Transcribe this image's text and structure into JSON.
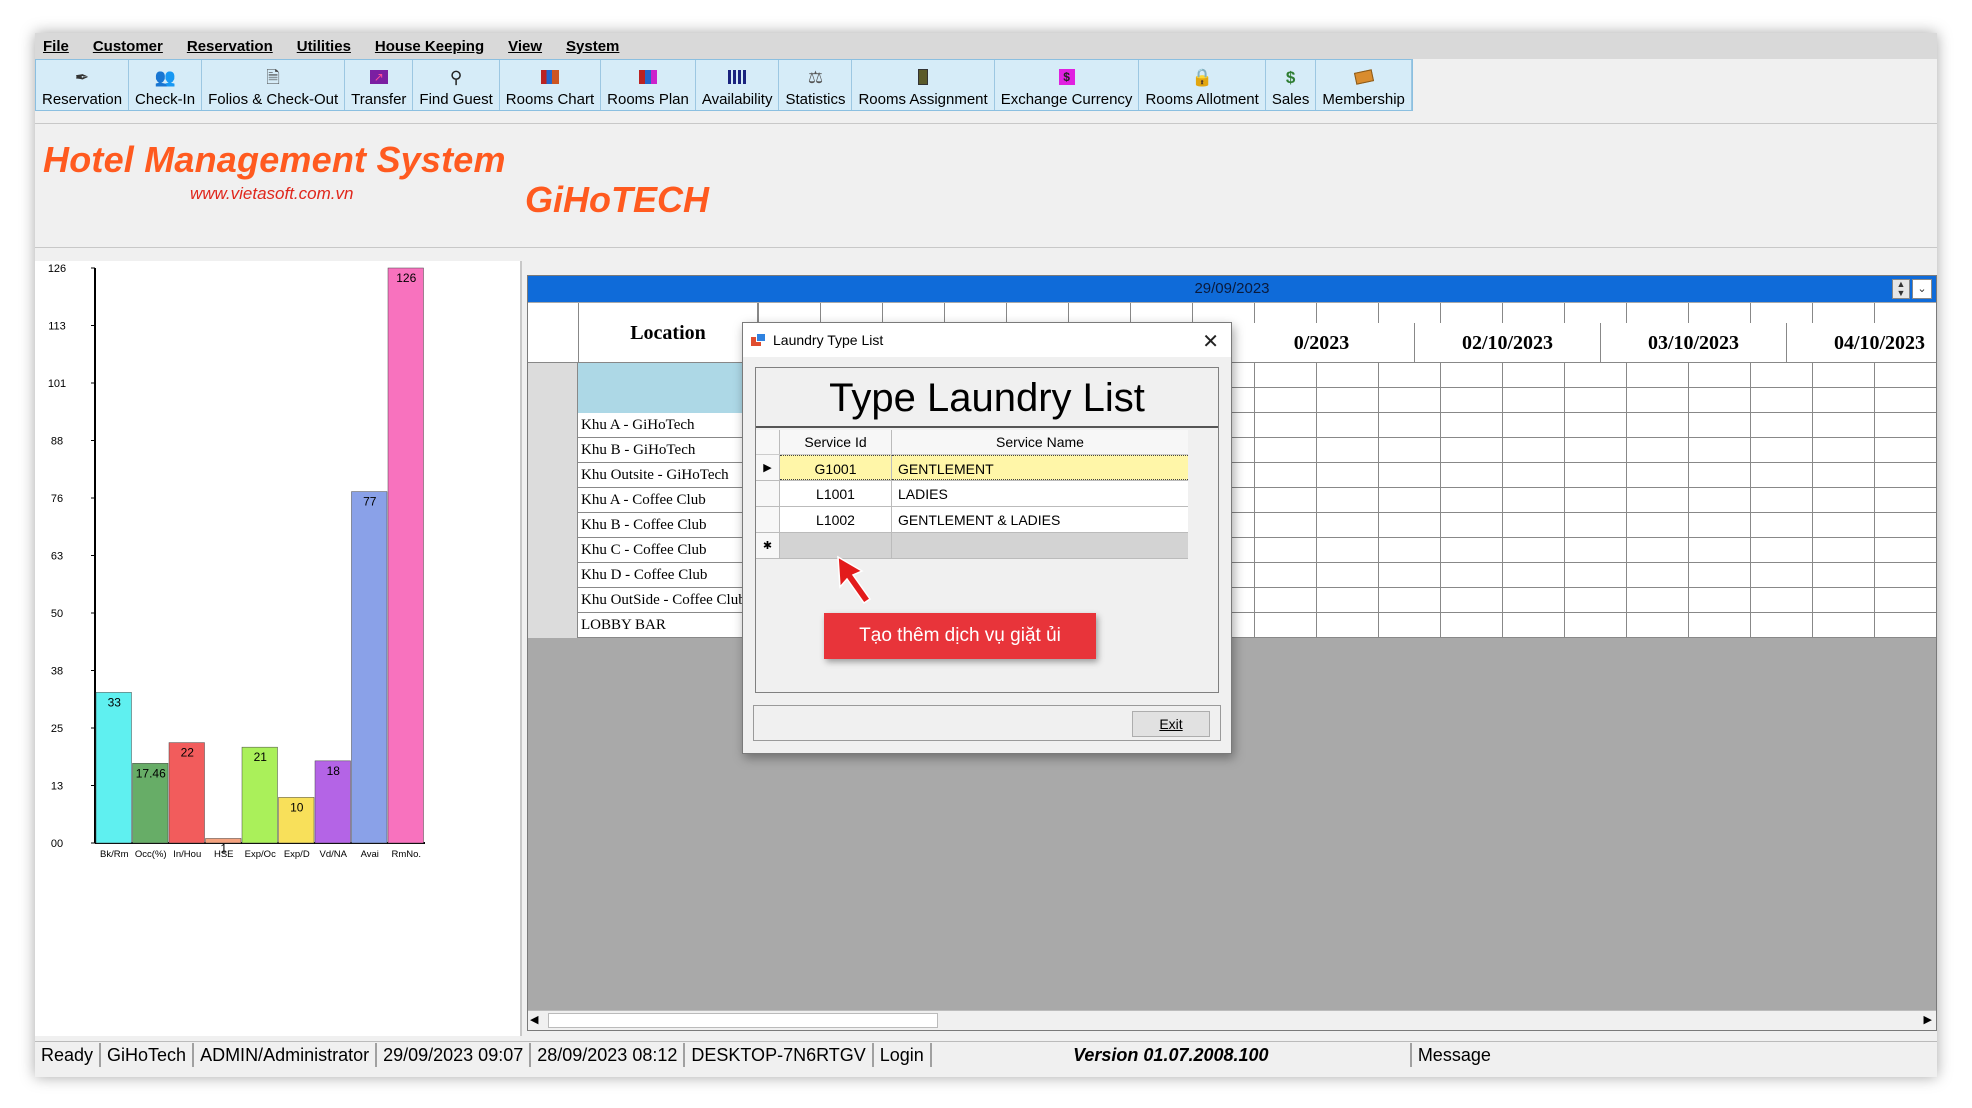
{
  "menu": [
    "File",
    "Customer",
    "Reservation",
    "Utilities",
    "House Keeping",
    "View",
    "System"
  ],
  "toolbar": [
    {
      "label": "Reservation",
      "icon": "pen-icon"
    },
    {
      "label": "Check-In",
      "icon": "people-icon"
    },
    {
      "label": "Folios & Check-Out",
      "icon": "folio-icon"
    },
    {
      "label": "Transfer",
      "icon": "transfer-icon"
    },
    {
      "label": "Find Guest",
      "icon": "binoculars-icon"
    },
    {
      "label": "Rooms Chart",
      "icon": "rooms-chart-icon"
    },
    {
      "label": "Rooms Plan",
      "icon": "rooms-plan-icon"
    },
    {
      "label": "Availability",
      "icon": "availability-icon"
    },
    {
      "label": "Statistics",
      "icon": "statistics-icon"
    },
    {
      "label": "Rooms Assignment",
      "icon": "assignment-icon"
    },
    {
      "label": "Exchange Currency",
      "icon": "currency-icon"
    },
    {
      "label": "Rooms Allotment",
      "icon": "lock-icon"
    },
    {
      "label": "Sales",
      "icon": "money-icon"
    },
    {
      "label": "Membership",
      "icon": "book-icon"
    }
  ],
  "header": {
    "title": "Hotel Management System",
    "website": "www.vietasoft.com.vn",
    "brand": "GiHoTECH"
  },
  "chart_data": {
    "type": "bar",
    "categories": [
      "Bk/Rm",
      "Occ(%)",
      "In/Hou",
      "HSE",
      "Exp/Oc",
      "Exp/D",
      "Vd/NA",
      "Avai",
      "RmNo."
    ],
    "values": [
      33,
      17.46,
      22,
      1,
      21,
      10,
      18,
      77,
      126
    ],
    "labels": [
      "33",
      "17.46",
      "22",
      "1",
      "21",
      "10",
      "18",
      "77",
      "126"
    ],
    "colors": [
      "#5ff0f0",
      "#67ad67",
      "#f25c5c",
      "#f4a27e",
      "#aaf05a",
      "#f8e05a",
      "#b464e6",
      "#8aa1e8",
      "#f872be"
    ],
    "yticks": [
      "00",
      "13",
      "25",
      "38",
      "50",
      "63",
      "76",
      "88",
      "101",
      "113",
      "126"
    ],
    "ylim": [
      0,
      126
    ],
    "grid": false
  },
  "grid": {
    "date": "29/09/2023",
    "location_header": "Location",
    "date_headers": [
      "0/2023",
      "02/10/2023",
      "03/10/2023",
      "04/10/2023"
    ],
    "locations": [
      "",
      "",
      "Khu A - GiHoTech",
      "Khu B - GiHoTech",
      "Khu Outsite - GiHoTech",
      "Khu A - Coffee Club",
      "Khu B - Coffee Club",
      "Khu C - Coffee Club",
      "Khu D - Coffee Club",
      "Khu OutSide - Coffee Club",
      "LOBBY BAR"
    ]
  },
  "dialog": {
    "title": "Laundry Type List",
    "heading": "Type Laundry List",
    "columns": [
      "Service Id",
      "Service Name"
    ],
    "rows": [
      {
        "id": "G1001",
        "name": "GENTLEMENT"
      },
      {
        "id": "L1001",
        "name": "LADIES"
      },
      {
        "id": "L1002",
        "name": "GENTLEMENT & LADIES"
      }
    ],
    "new_row_marker": "✱",
    "exit_label": "Exit"
  },
  "callout": "Tạo thêm dịch vụ giặt ủi",
  "status": {
    "ready": "Ready",
    "company": "GiHoTech",
    "user": "ADMIN/Administrator",
    "datetime1": "29/09/2023 09:07",
    "datetime2": "28/09/2023 08:12",
    "machine": "DESKTOP-7N6RTGV",
    "login": "Login",
    "version": "Version 01.07.2008.100",
    "message": "Message"
  }
}
